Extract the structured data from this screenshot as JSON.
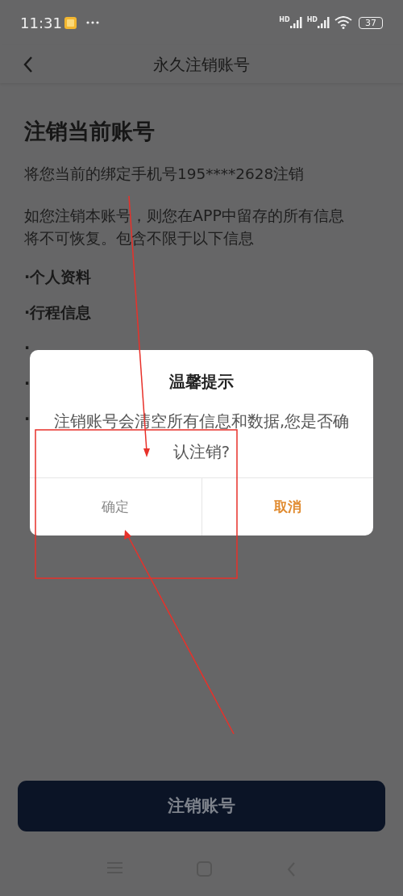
{
  "status_bar": {
    "time": "11:31",
    "signal_labels": [
      "HD",
      "HD"
    ],
    "battery": "37"
  },
  "nav": {
    "title": "永久注销账号"
  },
  "content": {
    "heading": "注销当前账号",
    "phone_line": "将您当前的绑定手机号195****2628注销",
    "notice": "如您注销本账号，则您在APP中留存的所有信息将不可恢复。包含不限于以下信息",
    "items": [
      "·个人资料",
      "·行程信息",
      "·",
      "·",
      "·"
    ]
  },
  "dialog": {
    "title": "温馨提示",
    "message": "注销账号会清空所有信息和数据,您是否确认注销?",
    "buttons": [
      {
        "label": "确定",
        "kind": "confirm"
      },
      {
        "label": "取消",
        "kind": "cancel"
      }
    ]
  },
  "primary_button": "注销账号"
}
